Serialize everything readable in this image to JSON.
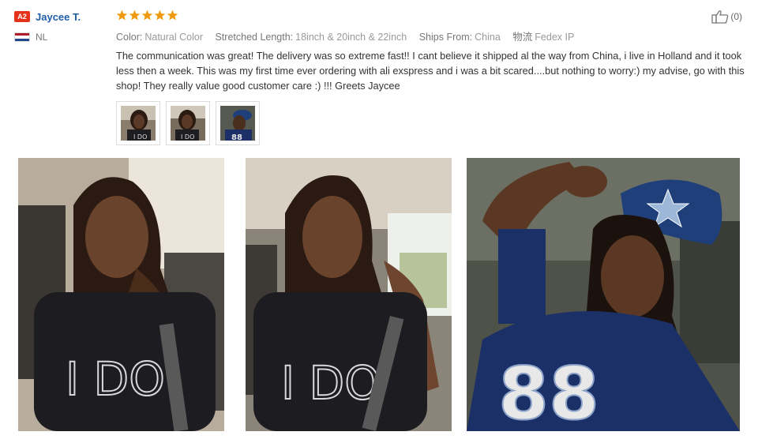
{
  "user": {
    "badge": "A2",
    "name": "Jaycee T.",
    "country": "NL",
    "flag_colors": [
      "#ae1c28",
      "#ffffff",
      "#21468b"
    ]
  },
  "rating": {
    "stars": 5,
    "max": 5,
    "star_color": "#f29b0f"
  },
  "attributes": [
    {
      "label": "Color:",
      "value": "Natural Color"
    },
    {
      "label": "Stretched Length:",
      "value": "18inch & 20inch & 22inch"
    },
    {
      "label": "Ships From:",
      "value": "China"
    },
    {
      "label": "物流",
      "value": "Fedex IP"
    }
  ],
  "review_text": "The communication was great! The delivery was so extreme fast!! I cant believe it shipped al the way from China, i live in Holland and it took less then a week. This was my first time ever ordering with ali exspress and i was a bit scared....but nothing to worry:) my advise, go with this shop! They really value good customer care :) !!! Greets Jaycee",
  "like": {
    "icon": "thumbs-up-icon",
    "count": "(0)"
  },
  "thumbnails": [
    {
      "icon": "photo-thumbnail-1"
    },
    {
      "icon": "photo-thumbnail-2"
    },
    {
      "icon": "photo-thumbnail-3"
    }
  ],
  "photos": [
    {
      "shirt_text": "I DO"
    },
    {
      "shirt_text": "I DO"
    },
    {
      "shirt_text": "88"
    }
  ],
  "colors": {
    "username": "#1f5ea8",
    "badge": "#e5331b",
    "muted": "#888888"
  }
}
